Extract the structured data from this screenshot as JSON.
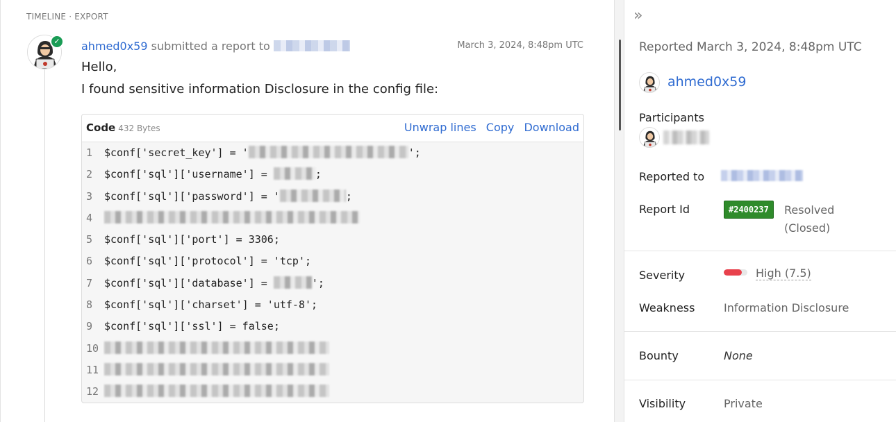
{
  "breadcrumb": "TIMELINE · EXPORT",
  "report": {
    "username": "ahmed0x59",
    "action_text": "submitted a report to",
    "timestamp": "March 3, 2024, 8:48pm UTC",
    "greeting": "Hello,",
    "message": "I found sensitive information Disclosure in the config file:"
  },
  "code": {
    "title": "Code",
    "size": "432 Bytes",
    "actions": [
      "Unwrap lines",
      "Copy",
      "Download"
    ],
    "lines": [
      {
        "n": "1",
        "text": "$conf['secret_key'] = '",
        "redacted": true,
        "after": "';"
      },
      {
        "n": "2",
        "text": "$conf['sql']['username'] = ",
        "redacted": true,
        "after": ";"
      },
      {
        "n": "3",
        "text": "$conf['sql']['password'] = '",
        "redacted": true,
        "after": ";"
      },
      {
        "n": "4",
        "text": "",
        "redacted": true,
        "after": ""
      },
      {
        "n": "5",
        "text": "$conf['sql']['port'] = 3306;",
        "redacted": false,
        "after": ""
      },
      {
        "n": "6",
        "text": "$conf['sql']['protocol'] = 'tcp';",
        "redacted": false,
        "after": ""
      },
      {
        "n": "7",
        "text": "$conf['sql']['database'] = ",
        "redacted": true,
        "after": "';"
      },
      {
        "n": "8",
        "text": "$conf['sql']['charset'] = 'utf-8';",
        "redacted": false,
        "after": ""
      },
      {
        "n": "9",
        "text": "$conf['sql']['ssl'] = false;",
        "redacted": false,
        "after": ""
      },
      {
        "n": "10",
        "text": "",
        "redacted": true,
        "after": ""
      },
      {
        "n": "11",
        "text": "",
        "redacted": true,
        "after": ""
      },
      {
        "n": "12",
        "text": "",
        "redacted": true,
        "after": ""
      }
    ]
  },
  "sidebar": {
    "reported_date": "Reported March 3, 2024, 8:48pm UTC",
    "username": "ahmed0x59",
    "participants_label": "Participants",
    "reported_to_label": "Reported to",
    "report_id_label": "Report Id",
    "report_id": "#2400237",
    "state": "Resolved (Closed)",
    "severity_label": "Severity",
    "severity": "High (7.5)",
    "severity_fraction": 0.75,
    "weakness_label": "Weakness",
    "weakness": "Information Disclosure",
    "bounty_label": "Bounty",
    "bounty": "None",
    "visibility_label": "Visibility",
    "visibility": "Private"
  },
  "colors": {
    "link": "#2f6bd1",
    "report_id_bg": "#2f8b2b",
    "severity_high": "#e8414c",
    "verified": "#1a9c55"
  }
}
